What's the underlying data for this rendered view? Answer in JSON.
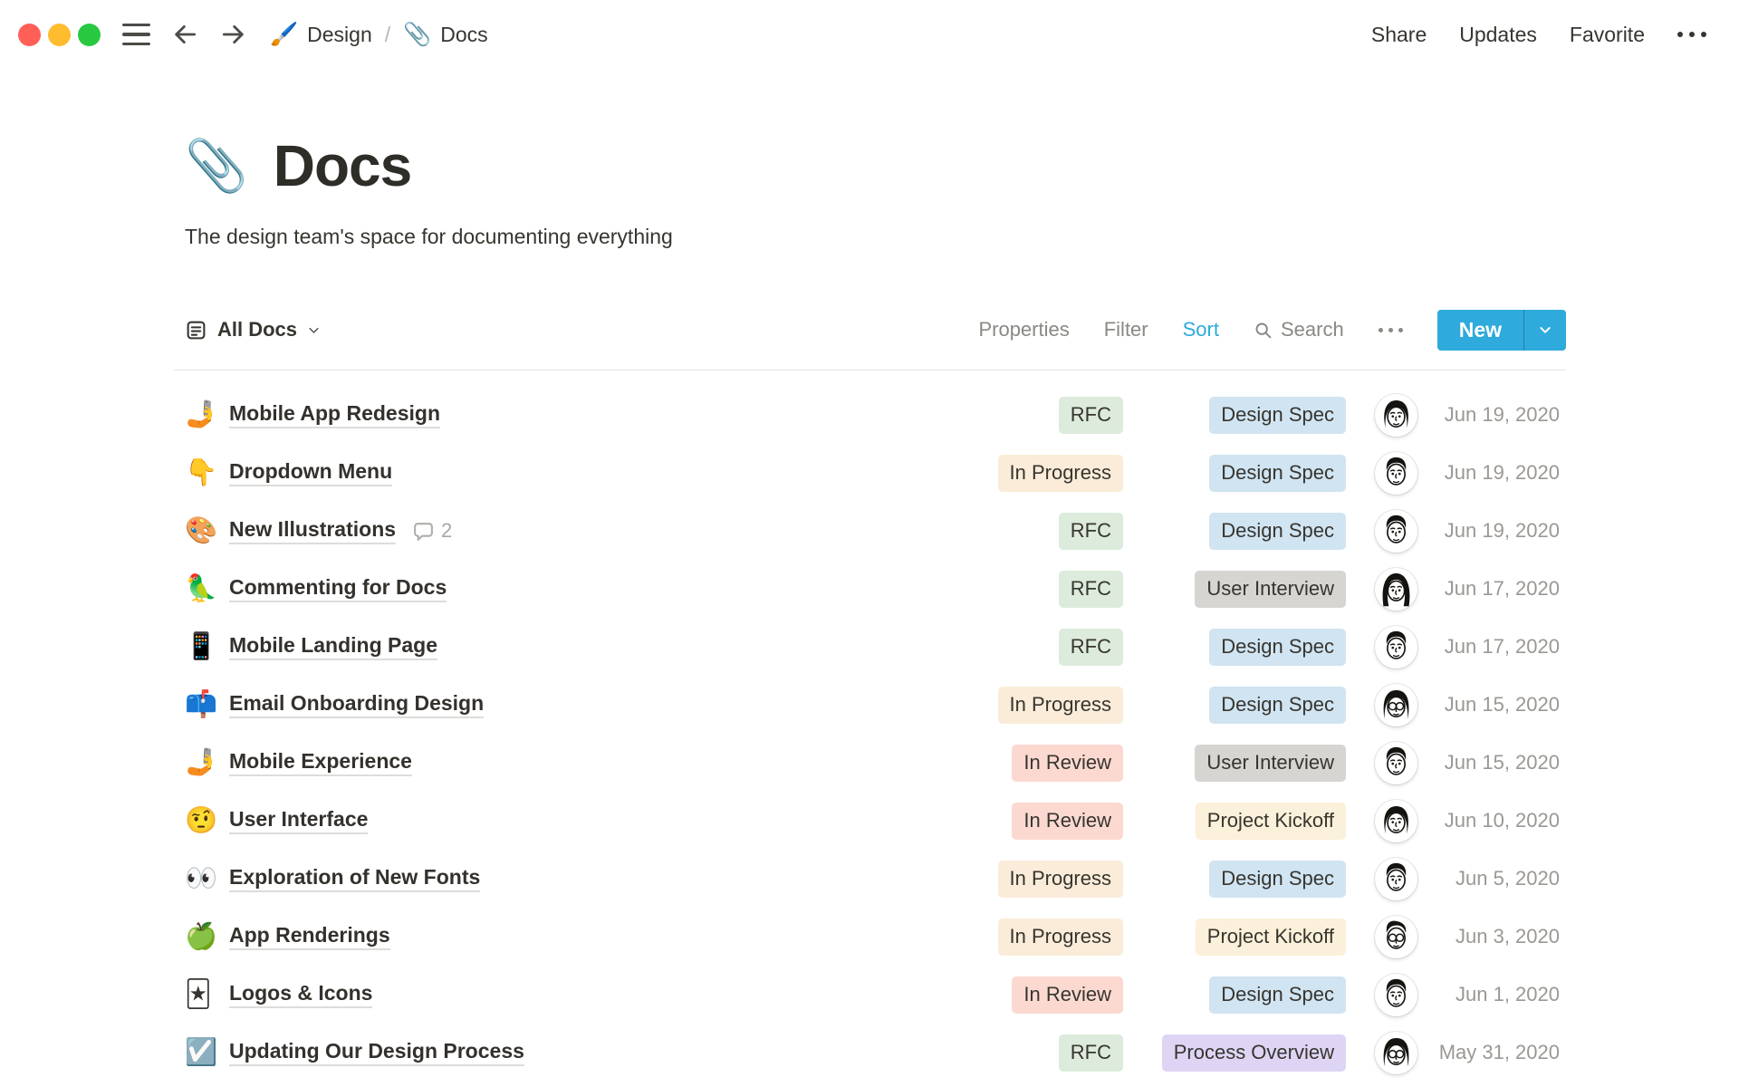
{
  "window": {
    "breadcrumb": {
      "section_icon": "🖌️",
      "section": "Design",
      "separator": "/",
      "page_icon": "📎",
      "page": "Docs"
    },
    "actions": {
      "share": "Share",
      "updates": "Updates",
      "favorite": "Favorite"
    }
  },
  "page": {
    "icon": "📎",
    "title": "Docs",
    "description": "The design team's space for documenting everything"
  },
  "toolbar": {
    "view_label": "All Docs",
    "properties": "Properties",
    "filter": "Filter",
    "sort": "Sort",
    "search": "Search",
    "new_label": "New"
  },
  "colors": {
    "accent": "#2eaadc",
    "sort_active": "#2eaadc"
  },
  "tag_colors": {
    "RFC": "#dcebdc",
    "Design Spec": "#d0e4f2",
    "In Progress": "#faecd9",
    "Project Kickoff": "#fbf0d9",
    "User Interview": "#d6d5d2",
    "In Review": "#fcd9d0",
    "Process Overview": "#ded5f5"
  },
  "rows": [
    {
      "icon": "🤳",
      "title": "Mobile App Redesign",
      "status": "RFC",
      "type": "Design Spec",
      "avatar": "woman",
      "date": "Jun 19, 2020"
    },
    {
      "icon": "👇",
      "title": "Dropdown Menu",
      "status": "In Progress",
      "type": "Design Spec",
      "avatar": "man",
      "date": "Jun 19, 2020"
    },
    {
      "icon": "🎨",
      "title": "New Illustrations",
      "comments": "2",
      "status": "RFC",
      "type": "Design Spec",
      "avatar": "man",
      "date": "Jun 19, 2020"
    },
    {
      "icon": "🦜",
      "title": "Commenting for Docs",
      "status": "RFC",
      "type": "User Interview",
      "avatar": "woman-long",
      "date": "Jun 17, 2020"
    },
    {
      "icon": "📱",
      "title": "Mobile Landing Page",
      "status": "RFC",
      "type": "Design Spec",
      "avatar": "man",
      "date": "Jun 17, 2020"
    },
    {
      "icon": "📫",
      "title": "Email Onboarding Design",
      "status": "In Progress",
      "type": "Design Spec",
      "avatar": "woman-glasses",
      "date": "Jun 15, 2020"
    },
    {
      "icon": "🤳",
      "title": "Mobile Experience",
      "status": "In Review",
      "type": "User Interview",
      "avatar": "man",
      "date": "Jun 15, 2020"
    },
    {
      "icon": "🤨",
      "title": "User Interface",
      "status": "In Review",
      "type": "Project Kickoff",
      "avatar": "woman",
      "date": "Jun 10, 2020"
    },
    {
      "icon": "👀",
      "title": "Exploration of New Fonts",
      "status": "In Progress",
      "type": "Design Spec",
      "avatar": "man",
      "date": "Jun 5, 2020"
    },
    {
      "icon": "🍏",
      "title": "App Renderings",
      "status": "In Progress",
      "type": "Project Kickoff",
      "avatar": "man-glasses",
      "date": "Jun 3, 2020"
    },
    {
      "icon": "🃏",
      "title": "Logos & Icons",
      "status": "In Review",
      "type": "Design Spec",
      "avatar": "man",
      "date": "Jun 1, 2020"
    },
    {
      "icon": "☑️",
      "title": "Updating Our Design Process",
      "status": "RFC",
      "type": "Process Overview",
      "avatar": "woman-glasses",
      "date": "May 31, 2020"
    }
  ]
}
